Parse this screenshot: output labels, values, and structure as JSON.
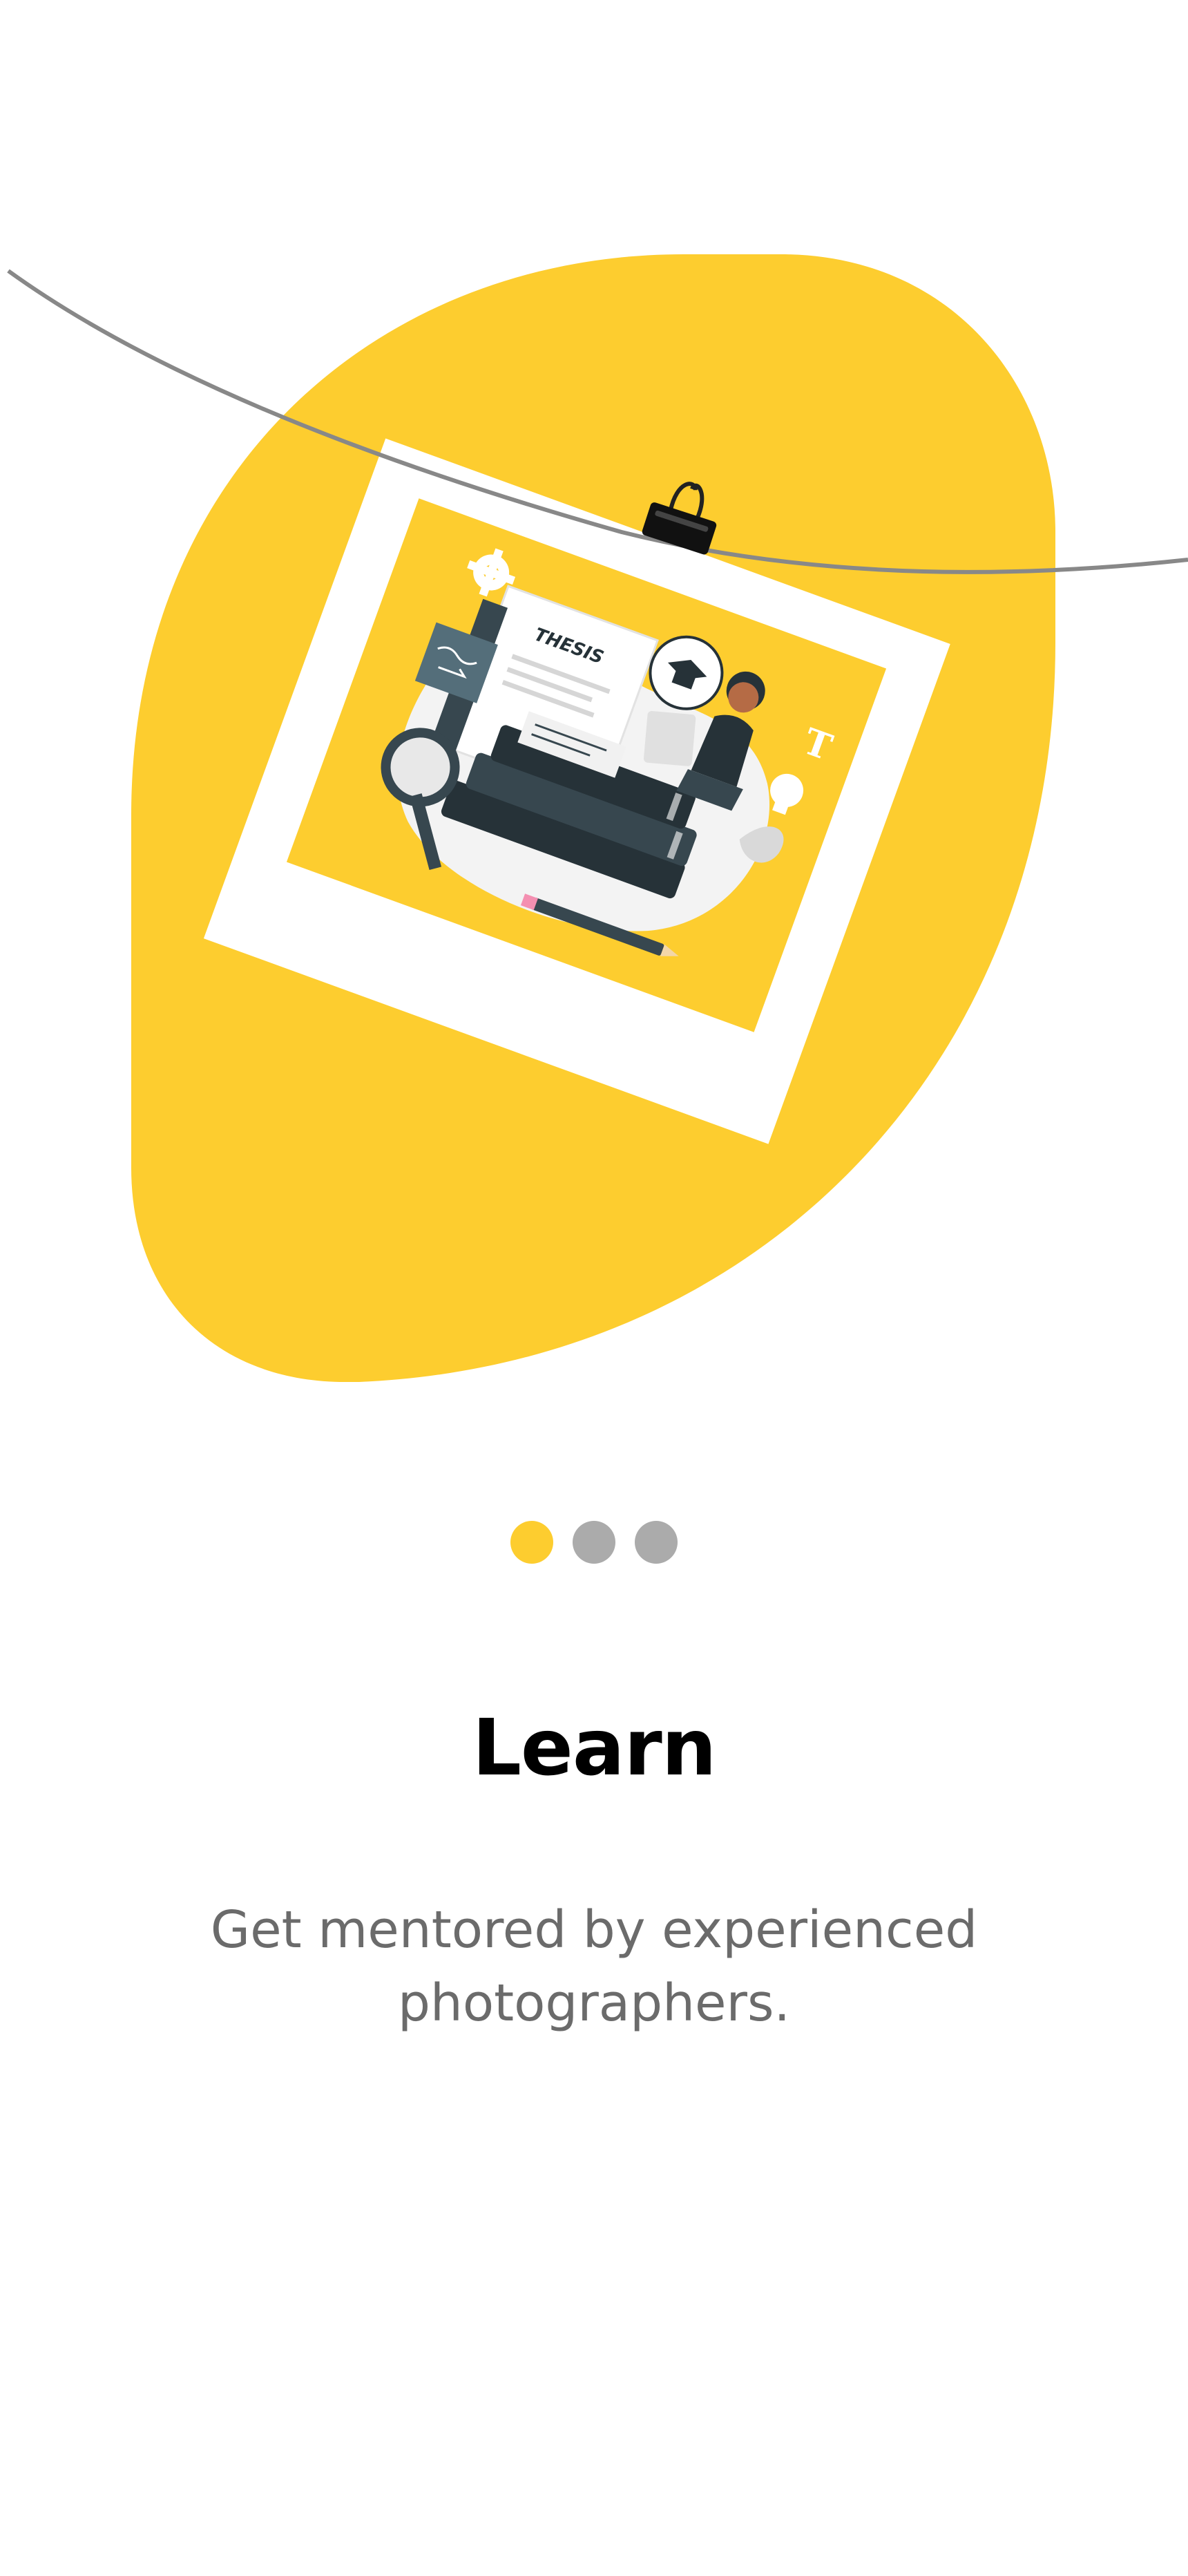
{
  "onboarding": {
    "title": "Learn",
    "subtitle": "Get mentored by experienced photographers.",
    "illustration": {
      "label": "THESIS",
      "icon": "student-thesis-illustration"
    },
    "pagination": {
      "total": 3,
      "active_index": 0,
      "active_color": "#FDCD2F",
      "inactive_color": "#ABABAB"
    }
  },
  "colors": {
    "accent": "#FDCD2F",
    "title": "#000000",
    "subtitle": "#6B6B6B",
    "background": "#FFFFFF"
  }
}
